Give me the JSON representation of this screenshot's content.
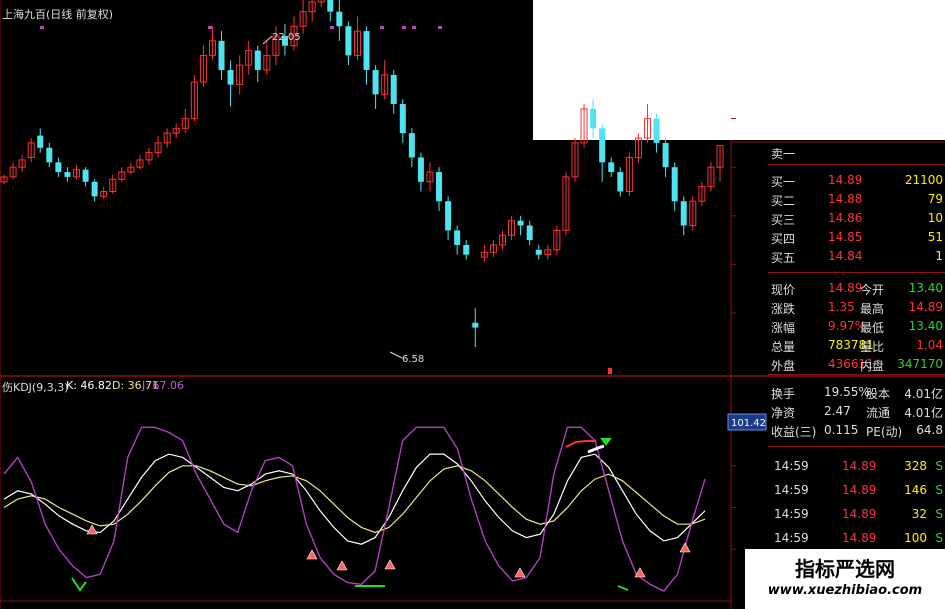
{
  "header": {
    "title": "上海九百(日线 前复权)",
    "indicator_name": "伤KDJ(9,3,3)",
    "k_label": "K: 46.82",
    "d_label": "D: 36.71",
    "j_label": "J: 67.06"
  },
  "annotations": {
    "high_label": "22.05",
    "low_label": "6.58",
    "cursor_value": "101.42"
  },
  "colors": {
    "up": "#ff3030",
    "down": "#4fe3f0",
    "grid": "#8a1010",
    "k_line": "#ffffff",
    "d_line": "#f0e68c",
    "j_line": "#b040c0",
    "label_red": "#ff3333",
    "label_green": "#22dd22",
    "label_yellow": "#ffee00"
  },
  "quote_panel": {
    "sell1_label": "卖一",
    "bids": [
      {
        "label": "买一",
        "price": "14.89",
        "vol": "21100"
      },
      {
        "label": "买二",
        "price": "14.88",
        "vol": "79"
      },
      {
        "label": "买三",
        "price": "14.86",
        "vol": "10"
      },
      {
        "label": "买四",
        "price": "14.85",
        "vol": "51"
      },
      {
        "label": "买五",
        "price": "14.84",
        "vol": "1"
      }
    ],
    "stats": [
      {
        "l1": "现价",
        "v1": "14.89",
        "l2": "今开",
        "v2": "13.40",
        "c1": "red",
        "c2": "green"
      },
      {
        "l1": "涨跌",
        "v1": "1.35",
        "l2": "最高",
        "v2": "14.89",
        "c1": "red",
        "c2": "red"
      },
      {
        "l1": "涨幅",
        "v1": "9.97%",
        "l2": "最低",
        "v2": "13.40",
        "c1": "red",
        "c2": "green"
      },
      {
        "l1": "总量",
        "v1": "783781",
        "l2": "量比",
        "v2": "1.04",
        "c1": "yellow",
        "c2": "red"
      },
      {
        "l1": "外盘",
        "v1": "436611",
        "l2": "内盘",
        "v2": "347170",
        "c1": "red",
        "c2": "green"
      }
    ],
    "stats2": [
      {
        "l1": "换手",
        "v1": "19.55%",
        "l2": "股本",
        "v2": "4.01亿"
      },
      {
        "l1": "净资",
        "v1": "2.47",
        "l2": "流通",
        "v2": "4.01亿"
      },
      {
        "l1": "收益(三)",
        "v1": "0.115",
        "l2": "PE(动)",
        "v2": "64.8"
      }
    ],
    "ticks": [
      {
        "time": "14:59",
        "price": "14.89",
        "vol": "328",
        "dir": "S"
      },
      {
        "time": "14:59",
        "price": "14.89",
        "vol": "146",
        "dir": "S"
      },
      {
        "time": "14:59",
        "price": "14.89",
        "vol": "32",
        "dir": "S"
      },
      {
        "time": "14:59",
        "price": "14.89",
        "vol": "100",
        "dir": "S"
      }
    ]
  },
  "watermark": {
    "title": "指标严选网",
    "url": "www.xuezhibiao.com"
  },
  "chart_data": [
    {
      "type": "candlestick",
      "y_ticks": [
        "16.00",
        "14.00",
        "12.00",
        "10.00",
        "8.00"
      ],
      "ylim": [
        6,
        18
      ],
      "candles": [
        [
          13.4,
          13.6,
          13.7,
          13.3
        ],
        [
          13.6,
          14.0,
          14.2,
          13.5
        ],
        [
          14.0,
          14.3,
          14.5,
          13.8
        ],
        [
          14.4,
          15.0,
          15.2,
          14.2
        ],
        [
          15.3,
          14.8,
          15.6,
          14.6
        ],
        [
          14.8,
          14.2,
          15.0,
          14.0
        ],
        [
          14.2,
          13.8,
          14.4,
          13.6
        ],
        [
          13.8,
          13.6,
          14.0,
          13.4
        ],
        [
          13.6,
          13.9,
          14.1,
          13.5
        ],
        [
          13.9,
          13.4,
          14.0,
          13.2
        ],
        [
          13.4,
          12.8,
          13.5,
          12.6
        ],
        [
          12.8,
          13.0,
          13.2,
          12.7
        ],
        [
          13.0,
          13.5,
          13.7,
          12.9
        ],
        [
          13.5,
          13.8,
          14.0,
          13.4
        ],
        [
          13.8,
          14.0,
          14.2,
          13.7
        ],
        [
          14.0,
          14.3,
          14.5,
          13.9
        ],
        [
          14.3,
          14.6,
          14.8,
          14.1
        ],
        [
          14.6,
          15.0,
          15.3,
          14.4
        ],
        [
          15.0,
          15.4,
          15.6,
          14.8
        ],
        [
          15.4,
          15.6,
          15.8,
          15.2
        ],
        [
          15.6,
          16.0,
          16.4,
          15.4
        ],
        [
          16.0,
          17.5,
          17.8,
          15.9
        ],
        [
          17.5,
          18.6,
          19.0,
          17.3
        ],
        [
          18.6,
          19.2,
          19.8,
          18.4
        ],
        [
          19.2,
          18.0,
          19.6,
          17.6
        ],
        [
          18.0,
          17.4,
          18.4,
          16.5
        ],
        [
          17.4,
          18.2,
          18.6,
          17.0
        ],
        [
          18.2,
          18.8,
          19.2,
          17.8
        ],
        [
          18.8,
          18.0,
          19.0,
          17.5
        ],
        [
          18.0,
          18.6,
          19.2,
          17.8
        ],
        [
          18.6,
          19.4,
          19.8,
          18.2
        ],
        [
          19.4,
          19.0,
          19.9,
          18.6
        ],
        [
          19.0,
          19.8,
          20.2,
          18.8
        ],
        [
          19.8,
          20.4,
          21.0,
          19.5
        ],
        [
          20.4,
          20.8,
          21.6,
          20.0
        ],
        [
          20.8,
          22.0,
          22.3,
          20.6
        ],
        [
          22.0,
          20.4,
          22.2,
          20.0
        ],
        [
          20.4,
          19.8,
          21.0,
          19.2
        ],
        [
          19.8,
          18.6,
          20.0,
          18.2
        ],
        [
          18.6,
          19.6,
          20.2,
          18.4
        ],
        [
          19.6,
          18.0,
          19.8,
          17.4
        ],
        [
          18.0,
          17.0,
          18.2,
          16.4
        ],
        [
          17.0,
          17.8,
          18.4,
          16.8
        ],
        [
          17.8,
          16.6,
          18.0,
          16.2
        ],
        [
          16.6,
          15.4,
          16.8,
          15.0
        ],
        [
          15.4,
          14.4,
          15.6,
          14.0
        ],
        [
          14.4,
          13.4,
          14.6,
          13.0
        ],
        [
          13.4,
          13.8,
          14.2,
          13.0
        ],
        [
          13.8,
          12.6,
          14.0,
          12.2
        ],
        [
          12.6,
          11.4,
          12.8,
          11.0
        ],
        [
          11.4,
          10.8,
          11.6,
          10.4
        ],
        [
          10.8,
          10.4,
          11.0,
          10.2
        ],
        [
          7.6,
          7.4,
          8.2,
          6.6
        ],
        [
          10.3,
          10.5,
          10.8,
          10.1
        ],
        [
          10.5,
          10.8,
          11.0,
          10.3
        ],
        [
          10.8,
          11.2,
          11.4,
          10.6
        ],
        [
          11.2,
          11.8,
          12.0,
          11.0
        ],
        [
          11.8,
          11.6,
          12.0,
          11.2
        ],
        [
          11.6,
          11.0,
          11.8,
          10.8
        ],
        [
          10.6,
          10.4,
          10.8,
          10.2
        ],
        [
          10.4,
          10.6,
          10.8,
          10.2
        ],
        [
          10.6,
          11.4,
          11.6,
          10.4
        ],
        [
          11.4,
          13.6,
          13.8,
          11.2
        ],
        [
          13.6,
          15.0,
          15.2,
          13.4
        ],
        [
          15.0,
          16.4,
          16.6,
          14.8
        ],
        [
          16.4,
          15.6,
          16.8,
          15.2
        ],
        [
          15.6,
          14.2,
          15.8,
          13.4
        ],
        [
          14.2,
          13.8,
          14.4,
          13.6
        ],
        [
          13.8,
          13.0,
          14.0,
          12.8
        ],
        [
          13.0,
          14.4,
          14.6,
          12.8
        ],
        [
          14.4,
          15.2,
          15.4,
          14.2
        ],
        [
          15.2,
          16.0,
          16.6,
          15.0
        ],
        [
          16.0,
          15.0,
          16.2,
          14.6
        ],
        [
          15.0,
          14.0,
          15.2,
          13.6
        ],
        [
          14.0,
          12.6,
          14.2,
          12.2
        ],
        [
          12.6,
          11.6,
          12.8,
          11.2
        ],
        [
          11.6,
          12.6,
          12.8,
          11.4
        ],
        [
          12.6,
          13.2,
          13.4,
          12.4
        ],
        [
          13.2,
          14.0,
          14.2,
          13.0
        ],
        [
          14.0,
          14.89,
          14.89,
          13.4
        ]
      ]
    },
    {
      "type": "line",
      "title": "KDJ(9,3,3)",
      "y_ticks": [
        "75.00",
        "50.00",
        "25.00"
      ],
      "ylim": [
        -10,
        110
      ],
      "series": [
        {
          "name": "K",
          "values": [
            55,
            60,
            58,
            52,
            45,
            40,
            36,
            35,
            42,
            55,
            68,
            78,
            82,
            80,
            74,
            68,
            62,
            60,
            64,
            70,
            72,
            70,
            60,
            48,
            38,
            30,
            28,
            32,
            44,
            60,
            74,
            82,
            82,
            76,
            66,
            54,
            44,
            36,
            32,
            34,
            46,
            66,
            80,
            82,
            74,
            60,
            46,
            36,
            30,
            32,
            40,
            48
          ]
        },
        {
          "name": "D",
          "values": [
            50,
            55,
            57,
            55,
            50,
            46,
            42,
            39,
            40,
            46,
            54,
            63,
            71,
            75,
            75,
            72,
            68,
            64,
            63,
            66,
            68,
            69,
            66,
            60,
            52,
            44,
            38,
            35,
            38,
            46,
            56,
            66,
            73,
            75,
            72,
            66,
            58,
            50,
            43,
            40,
            42,
            50,
            60,
            67,
            70,
            66,
            59,
            52,
            45,
            40,
            40,
            43
          ]
        },
        {
          "name": "J",
          "values": [
            70,
            80,
            65,
            40,
            25,
            15,
            8,
            10,
            30,
            80,
            98,
            98,
            95,
            90,
            70,
            55,
            40,
            35,
            60,
            78,
            80,
            75,
            40,
            20,
            10,
            5,
            4,
            12,
            50,
            90,
            98,
            98,
            98,
            85,
            55,
            30,
            15,
            6,
            8,
            20,
            70,
            98,
            98,
            90,
            60,
            30,
            10,
            4,
            0,
            10,
            40,
            67
          ]
        }
      ]
    }
  ]
}
